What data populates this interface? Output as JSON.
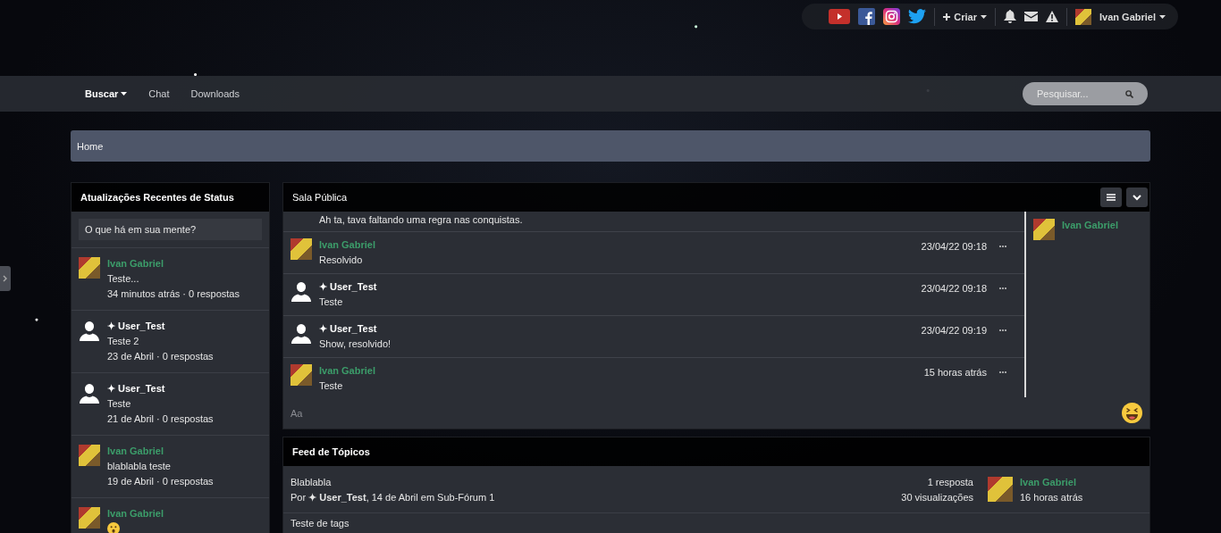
{
  "top_bar": {
    "create_label": "Criar",
    "user_name": "Ivan Gabriel"
  },
  "nav": {
    "items": [
      {
        "label": "Buscar",
        "selected": true,
        "has_menu": true
      },
      {
        "label": "Chat",
        "selected": false,
        "has_menu": false
      },
      {
        "label": "Downloads",
        "selected": false,
        "has_menu": false
      }
    ],
    "search": {
      "placeholder": "Pesquisar..."
    }
  },
  "breadcrumb": [
    "Home"
  ],
  "status_panel": {
    "title": "Atualizações Recentes de Status",
    "input": {
      "placeholder": "O que há em sua mente?"
    },
    "items": [
      {
        "author": "Ivan Gabriel",
        "kind": "member",
        "text": "Teste...",
        "meta": "34 minutos atrás · 0 respostas"
      },
      {
        "author": "✦ User_Test",
        "kind": "guest",
        "text": "Teste 2",
        "meta": "23 de Abril · 0 respostas"
      },
      {
        "author": "✦ User_Test",
        "kind": "guest",
        "text": "Teste",
        "meta": "21 de Abril · 0 respostas"
      },
      {
        "author": "Ivan Gabriel",
        "kind": "member",
        "text": "blablabla teste",
        "meta": "19 de Abril · 0 respostas"
      },
      {
        "author": "Ivan Gabriel",
        "kind": "member"
      }
    ]
  },
  "chat": {
    "title": "Sala Pública",
    "messages": [
      {
        "kind": "continued",
        "text": "Ah ta, tava faltando uma regra nas conquistas."
      },
      {
        "author": "Ivan Gabriel",
        "kind": "member",
        "text": "Resolvido",
        "time": "23/04/22 09:18"
      },
      {
        "author": "✦ User_Test",
        "kind": "guest",
        "text": "Teste",
        "time": "23/04/22 09:18"
      },
      {
        "author": "✦ User_Test",
        "kind": "guest",
        "text": "Show, resolvido!",
        "time": "23/04/22 09:19"
      },
      {
        "author": "Ivan Gabriel",
        "kind": "member",
        "text": "Teste",
        "time": "15 horas atrás"
      }
    ],
    "online_users": [
      {
        "name": "Ivan Gabriel",
        "kind": "member"
      }
    ],
    "input": {
      "placeholder": "Aa"
    }
  },
  "feed": {
    "title": "Feed de Tópicos",
    "topics": [
      {
        "title": "Blablabla",
        "byline": "Por **✦ User_Test**, 14 de Abril em Sub-Fórum 1",
        "replies": "1 resposta",
        "views": "30 visualizações",
        "last_author": "Ivan Gabriel",
        "last_time": "16 horas atrás"
      },
      {
        "title": "Teste de tags"
      }
    ]
  }
}
